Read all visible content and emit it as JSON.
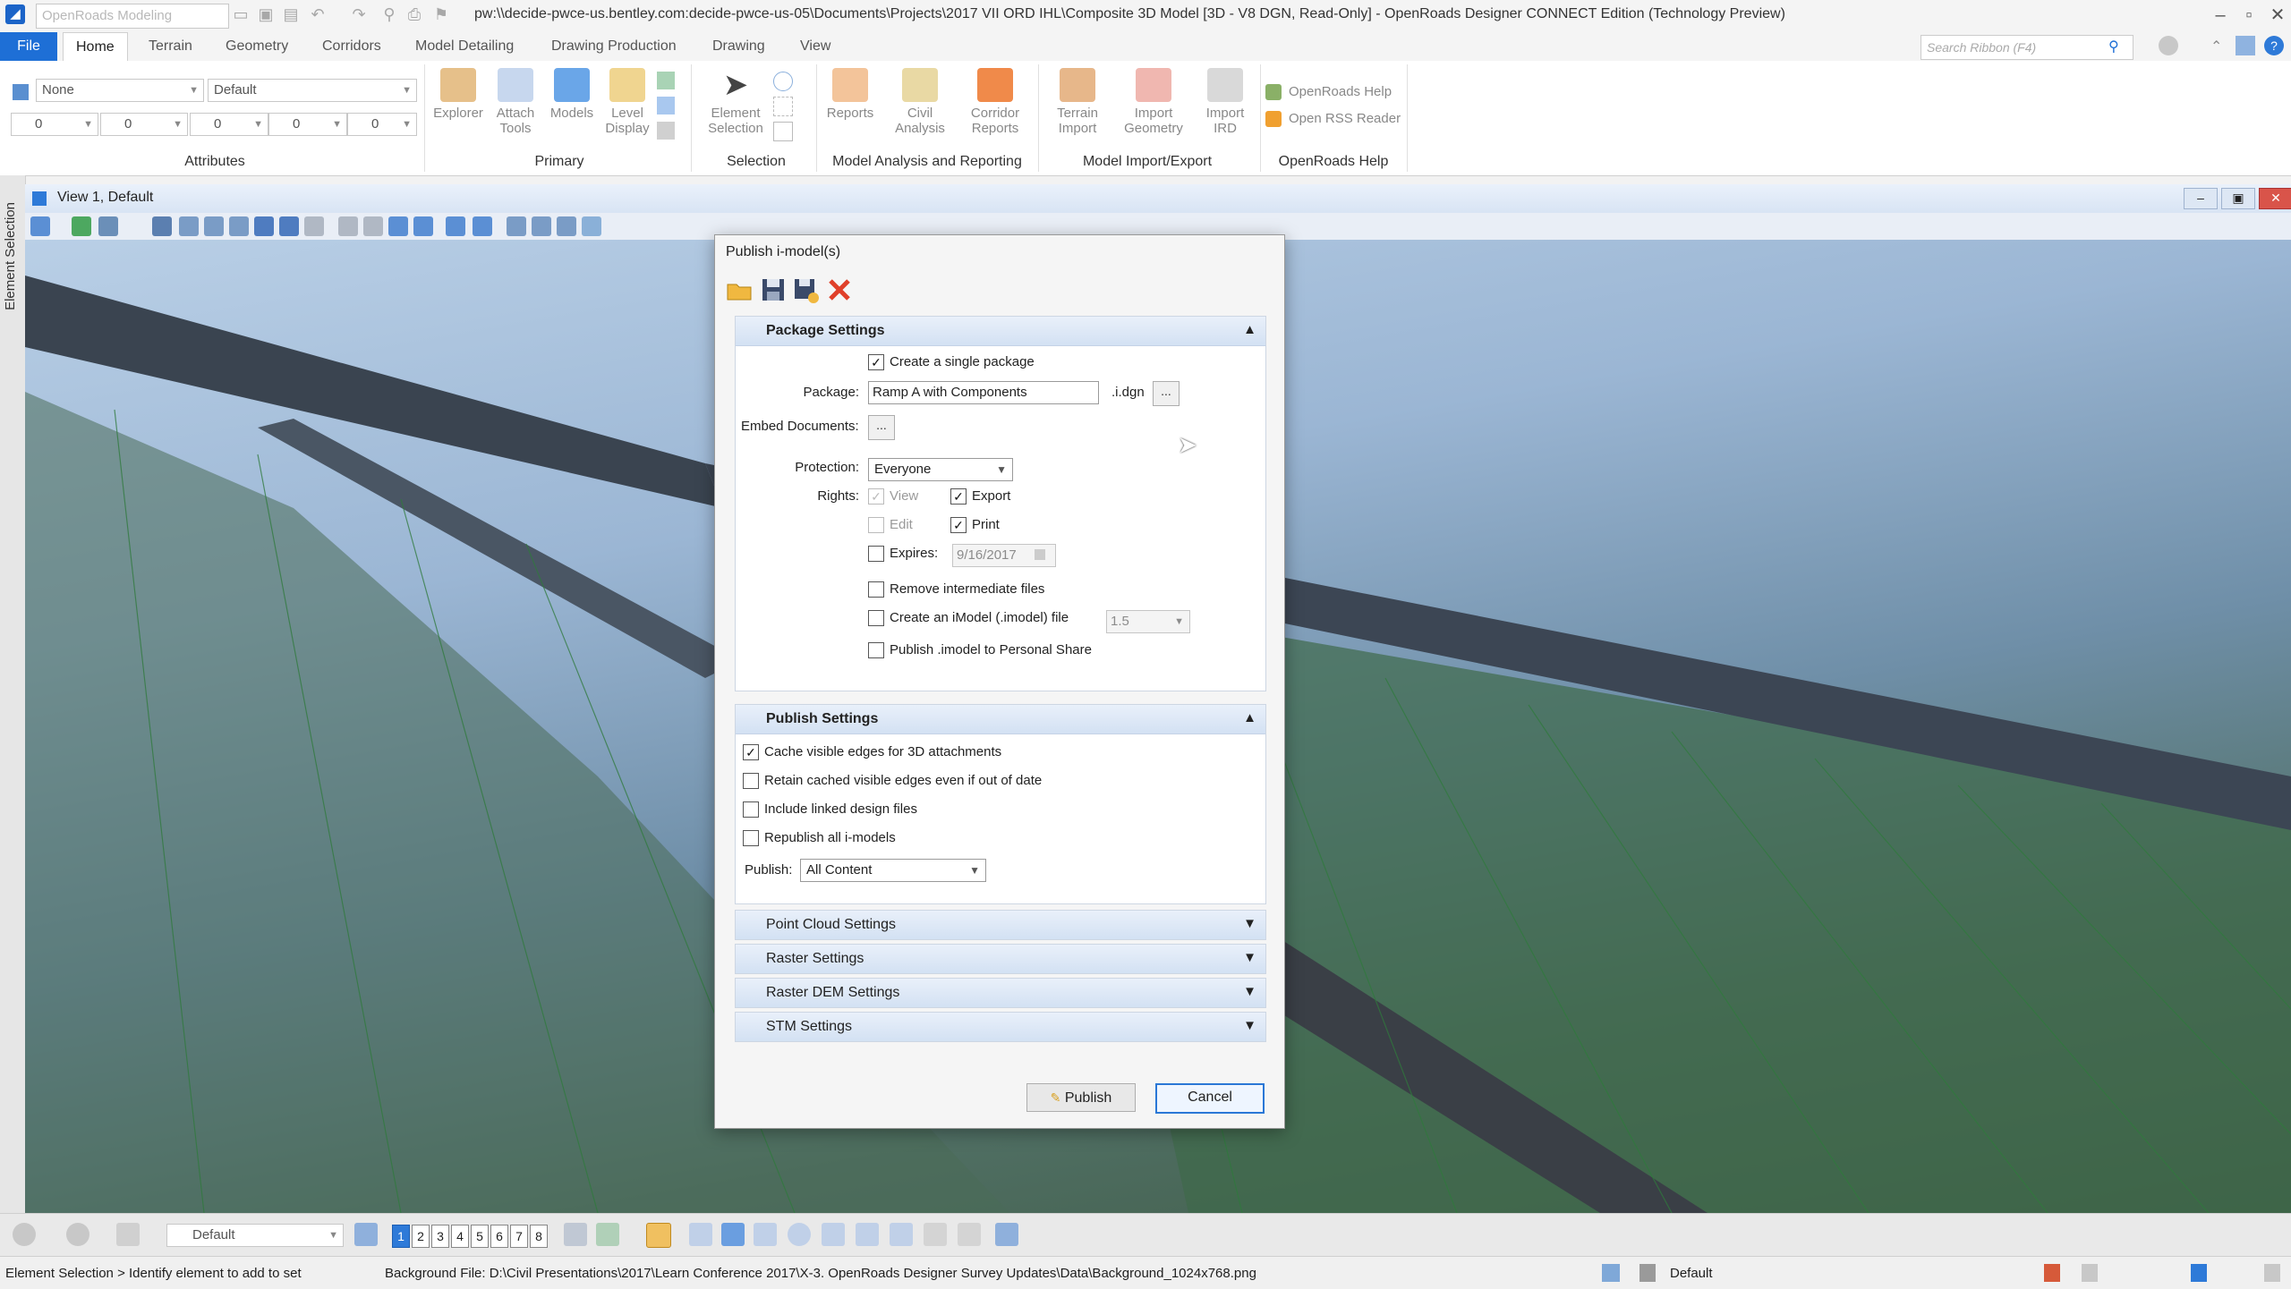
{
  "app": {
    "workspace": "OpenRoads Modeling",
    "window_title": "pw:\\\\decide-pwce-us.bentley.com:decide-pwce-us-05\\Documents\\Projects\\2017 VII ORD IHL\\Composite 3D Model [3D - V8 DGN, Read-Only] - OpenRoads Designer CONNECT Edition (Technology Preview)"
  },
  "ribbon": {
    "file_tab": "File",
    "tabs": [
      "Home",
      "Terrain",
      "Geometry",
      "Corridors",
      "Model Detailing",
      "Drawing Production",
      "Drawing",
      "View"
    ],
    "search_placeholder": "Search Ribbon (F4)",
    "attributes": {
      "level": "None",
      "style": "Default",
      "weight": "0",
      "line": "0",
      "color": "0",
      "trans": "0",
      "prio": "0",
      "label": "Attributes"
    },
    "primary": {
      "explorer": "Explorer",
      "attach_1": "Attach",
      "attach_2": "Tools",
      "models": "Models",
      "level_1": "Level",
      "level_2": "Display",
      "label": "Primary"
    },
    "selection": {
      "elem_1": "Element",
      "elem_2": "Selection",
      "label": "Selection"
    },
    "analysis": {
      "reports": "Reports",
      "civil_1": "Civil",
      "civil_2": "Analysis",
      "corr_1": "Corridor",
      "corr_2": "Reports",
      "label": "Model Analysis and Reporting"
    },
    "import": {
      "terrain_1": "Terrain",
      "terrain_2": "Import",
      "geom_1": "Import",
      "geom_2": "Geometry",
      "ird_1": "Import",
      "ird_2": "IRD",
      "label": "Model Import/Export"
    },
    "help": {
      "help": "OpenRoads Help",
      "rss": "Open RSS Reader",
      "label": "OpenRoads Help"
    }
  },
  "view": {
    "side_label": "Element Selection",
    "title": "View 1, Default"
  },
  "dialog": {
    "title": "Publish i-model(s)",
    "package_settings": {
      "header": "Package Settings",
      "single_package": "Create a single package",
      "package_label": "Package:",
      "package_value": "Ramp A with Components",
      "ext": ".i.dgn",
      "browse": "...",
      "embed_label": "Embed Documents:",
      "protection_label": "Protection:",
      "protection_value": "Everyone",
      "rights_label": "Rights:",
      "view": "View",
      "export": "Export",
      "edit": "Edit",
      "print": "Print",
      "expires_label": "Expires:",
      "expires_value": "9/16/2017",
      "remove_intermediate": "Remove intermediate files",
      "create_imodel": "Create an iModel (.imodel) file",
      "imodel_version": "1.5",
      "publish_personal": "Publish .imodel to Personal Share"
    },
    "publish_settings": {
      "header": "Publish Settings",
      "cache_edges": "Cache visible edges for 3D attachments",
      "retain_edges": "Retain cached visible edges even if out of date",
      "include_linked": "Include linked design files",
      "republish": "Republish all i-models",
      "publish_label": "Publish:",
      "publish_value": "All Content"
    },
    "collapsed_sections": [
      "Point Cloud Settings",
      "Raster Settings",
      "Raster DEM Settings",
      "STM Settings"
    ],
    "publish_button": "Publish",
    "cancel_button": "Cancel"
  },
  "navbar": {
    "view_group": "Default",
    "view_numbers": [
      "1",
      "2",
      "3",
      "4",
      "5",
      "6",
      "7",
      "8"
    ]
  },
  "status": {
    "prompt": "Element Selection > Identify element to add to set",
    "message": "Background File: D:\\Civil Presentations\\2017\\Learn Conference 2017\\X-3. OpenRoads Designer Survey Updates\\Data\\Background_1024x768.png",
    "active_model": "Default"
  },
  "colors": {
    "accent": "#1e6fd6",
    "section_header": "#d3e1f3",
    "terrain": "#4f6e62"
  }
}
